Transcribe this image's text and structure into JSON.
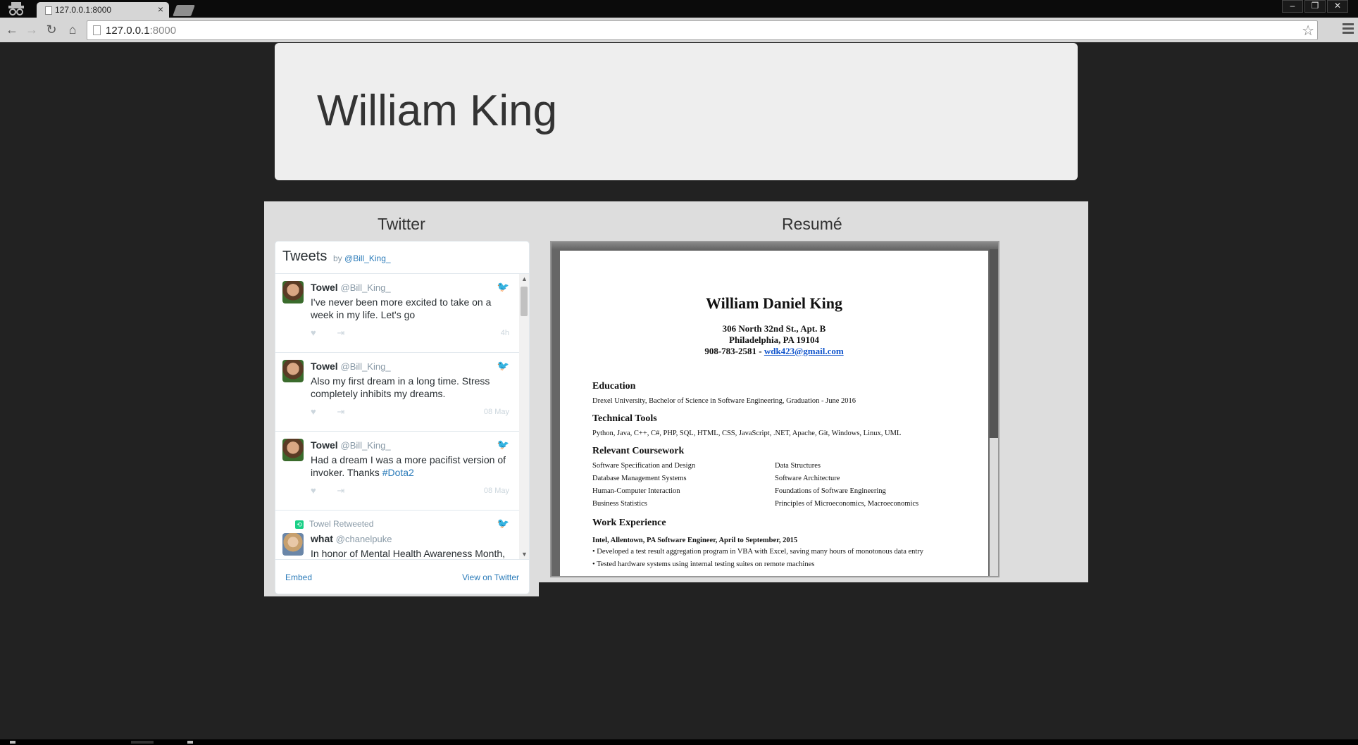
{
  "browser": {
    "tab_title": "127.0.0.1:8000",
    "tab_close": "×",
    "url_host": "127.0.0.1",
    "url_port": ":8000",
    "star": "☆",
    "window_minimize": "–",
    "window_restore": "❐",
    "window_close": "✕",
    "nav_back": "←",
    "nav_forward": "→",
    "nav_reload": "↻",
    "nav_home": "⌂"
  },
  "header": {
    "name": "William King"
  },
  "columns": {
    "twitter_title": "Twitter",
    "resume_title": "Resumé"
  },
  "twitter": {
    "widget_title": "Tweets",
    "by_prefix": "by",
    "by_handle": "@Bill_King_",
    "bird_icon": "🐦",
    "like_icon": "♥",
    "share_icon": "⇥",
    "tweets": [
      {
        "name": "Towel",
        "handle": "@Bill_King_",
        "text": "I've never been more excited to take on a week in my life. Let's go",
        "hashtag": "",
        "time": "4h"
      },
      {
        "name": "Towel",
        "handle": "@Bill_King_",
        "text": "Also my first dream in a long time. Stress completely inhibits my dreams.",
        "hashtag": "",
        "time": "08 May"
      },
      {
        "name": "Towel",
        "handle": "@Bill_King_",
        "text": "Had a dream I was a more pacifist version of invoker. Thanks ",
        "hashtag": "#Dota2",
        "time": "08 May"
      }
    ],
    "retweet": {
      "rt_label": "Towel Retweeted",
      "rt_icon": "⟲",
      "name": "what",
      "handle": "@chanelpuke",
      "text": "In honor of Mental Health Awareness Month,"
    },
    "scroll_up": "▲",
    "scroll_down": "▼",
    "footer_embed": "Embed",
    "footer_view": "View on Twitter"
  },
  "resume": {
    "name": "William Daniel King",
    "address1": "306 North 32nd St., Apt. B",
    "address2": "Philadelphia, PA 19104",
    "phone": "908-783-2581 - ",
    "email": "wdk423@gmail.com",
    "education_h": "Education",
    "education": "Drexel University, Bachelor of Science in Software Engineering, Graduation - June 2016",
    "tools_h": "Technical Tools",
    "tools": "Python, Java, C++, C#, PHP, SQL, HTML, CSS, JavaScript, .NET, Apache, Git, Windows, Linux, UML",
    "coursework_h": "Relevant Coursework",
    "coursework_left": [
      "Software Specification and Design",
      "Database Management Systems",
      "Human-Computer Interaction",
      "Business Statistics"
    ],
    "coursework_right": [
      "Data Structures",
      "Software Architecture",
      "Foundations of Software Engineering",
      "Principles of Microeconomics, Macroeconomics"
    ],
    "work_h": "Work Experience",
    "job_title": "Intel, Allentown, PA Software Engineer, April to September, 2015",
    "bullets": [
      "• Developed a test result aggregation program in VBA with Excel, saving many hours of monotonous data entry",
      "• Tested hardware systems using internal testing suites on remote machines"
    ]
  }
}
